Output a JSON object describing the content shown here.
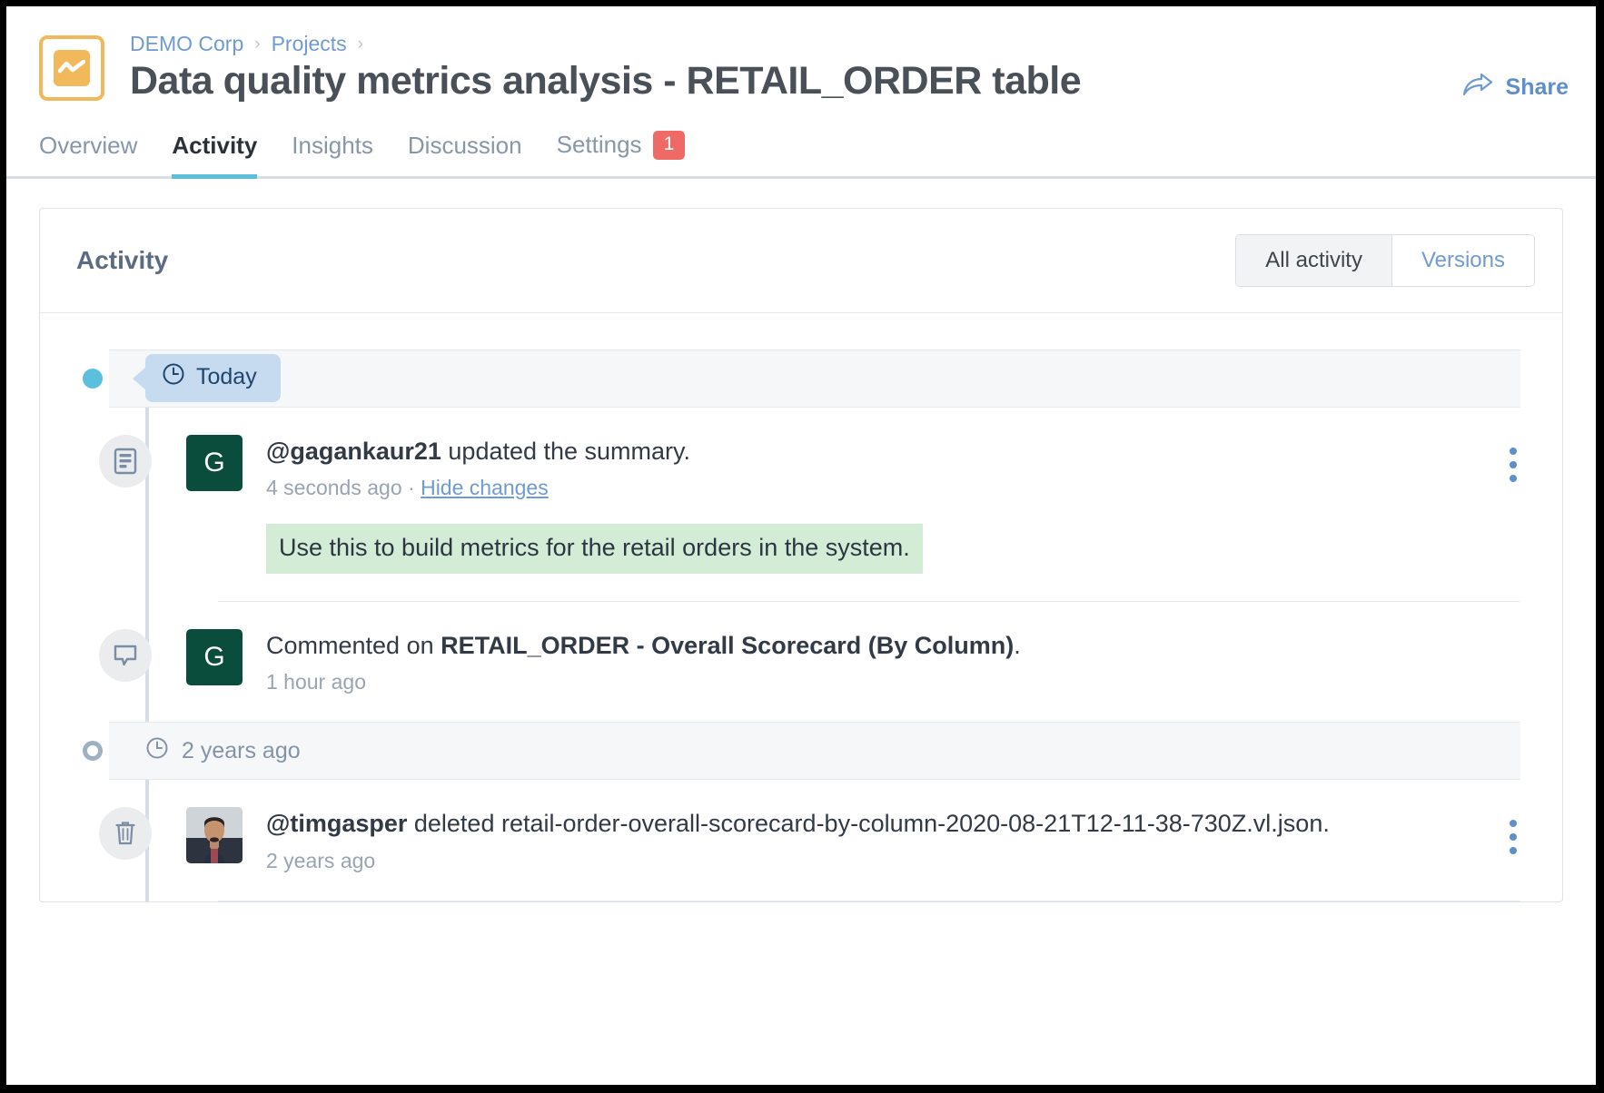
{
  "header": {
    "logo_icon": "chart-line-icon",
    "breadcrumb": [
      {
        "label": "DEMO Corp"
      },
      {
        "label": "Projects"
      }
    ],
    "breadcrumb_separator": "›",
    "title": "Data quality metrics analysis - RETAIL_ORDER table",
    "share_label": "Share",
    "share_icon": "share-arrow-icon"
  },
  "tabs": [
    {
      "label": "Overview",
      "active": false
    },
    {
      "label": "Activity",
      "active": true
    },
    {
      "label": "Insights",
      "active": false
    },
    {
      "label": "Discussion",
      "active": false
    },
    {
      "label": "Settings",
      "active": false,
      "badge": "1"
    }
  ],
  "colors": {
    "accent_blue": "#5bc0de",
    "link_blue": "#6e9bd2",
    "badge_red": "#ef6a64",
    "logo_orange": "#f2b95c",
    "avatar_green": "#0b4d3c",
    "diff_add_green": "#d2ecd6",
    "chip_blue": "#c6dbef"
  },
  "card": {
    "title": "Activity",
    "filters": [
      {
        "label": "All activity",
        "active": true
      },
      {
        "label": "Versions",
        "active": false
      }
    ]
  },
  "timeline": [
    {
      "kind": "date",
      "style": "chip",
      "icon": "clock-icon",
      "label": "Today",
      "dot": "filled"
    },
    {
      "kind": "entry",
      "icon": "document-summary-icon",
      "avatar": {
        "type": "letter",
        "letter": "G"
      },
      "actor": "@gagankaur21",
      "action": " updated the summary.",
      "time": "4 seconds ago",
      "sub_separator": " · ",
      "sub_link": "Hide changes",
      "diff_added": "Use this to build metrics for the retail orders in the system.",
      "menu_icon": "kebab-menu-icon"
    },
    {
      "kind": "entry",
      "icon": "comment-icon",
      "avatar": {
        "type": "letter",
        "letter": "G"
      },
      "actor": "",
      "action": "Commented on ",
      "target": "RETAIL_ORDER - Overall Scorecard (By Column)",
      "action_suffix": ".",
      "time": "1 hour ago"
    },
    {
      "kind": "date",
      "style": "plain",
      "icon": "clock-icon",
      "label": "2 years ago",
      "dot": "hollow"
    },
    {
      "kind": "entry",
      "icon": "trash-icon",
      "avatar": {
        "type": "photo",
        "alt": "timgasper-avatar"
      },
      "actor": "@timgasper",
      "action": " deleted retail-order-overall-scorecard-by-column-2020-08-21T12-11-38-730Z.vl.json.",
      "time": "2 years ago",
      "menu_icon": "kebab-menu-icon"
    }
  ]
}
